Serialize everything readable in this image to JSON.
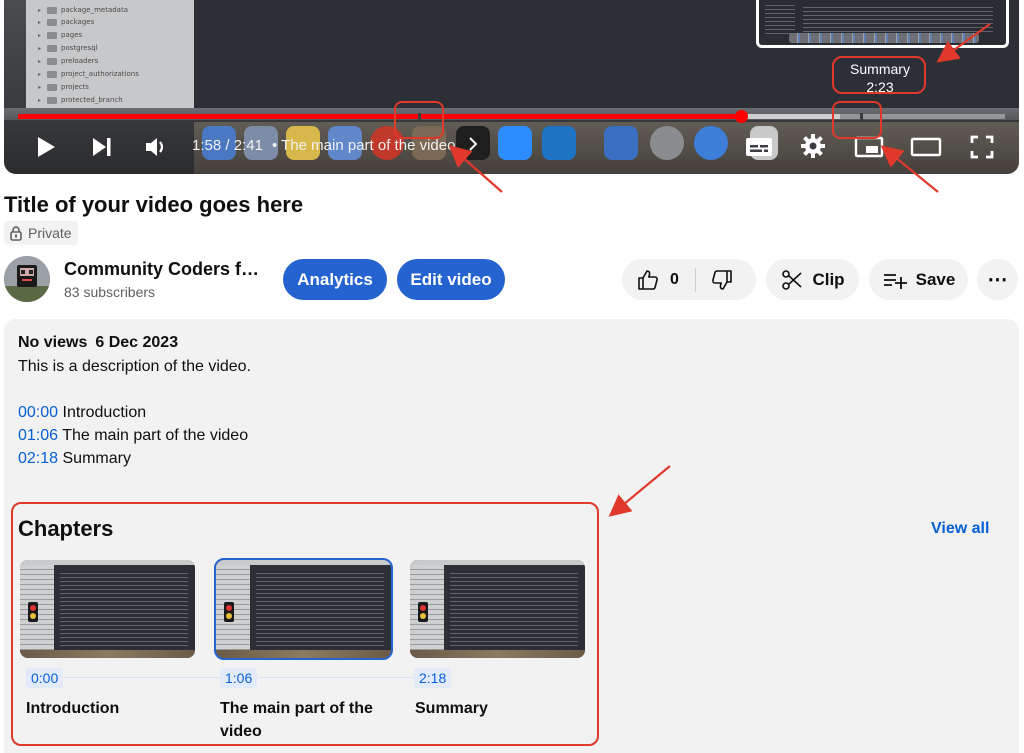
{
  "player": {
    "file_tree": [
      "package_metadata",
      "packages",
      "pages",
      "postgresql",
      "preloaders",
      "project_authorizations",
      "projects",
      "protected_branch"
    ],
    "time_current": "1:58",
    "time_separator": "/",
    "time_total": "2:41",
    "chapter_separator": "•",
    "current_chapter": "The main part of the video",
    "progress_fraction": 0.733,
    "tooltip": {
      "title": "Summary",
      "time": "2:23"
    },
    "colors": {
      "progress": "#ff0000",
      "annotation": "#e0392b"
    }
  },
  "video": {
    "title": "Title of your video goes here",
    "visibility": "Private"
  },
  "channel": {
    "name": "Community Coders f…",
    "subscribers": "83 subscribers"
  },
  "actions": {
    "analytics": "Analytics",
    "edit_video": "Edit video",
    "likes": "0",
    "clip": "Clip",
    "save": "Save",
    "more": "⋯"
  },
  "description": {
    "views": "No views",
    "date": "6 Dec 2023",
    "text": "This is a description of the video.",
    "timestamps": [
      {
        "time": "00:00",
        "label": "Introduction"
      },
      {
        "time": "01:06",
        "label": "The main part of the video"
      },
      {
        "time": "02:18",
        "label": "Summary"
      }
    ]
  },
  "chapters": {
    "heading": "Chapters",
    "view_all": "View all",
    "items": [
      {
        "time": "0:00",
        "title": "Introduction",
        "active": false
      },
      {
        "time": "1:06",
        "title": "The main part of the video",
        "active": true
      },
      {
        "time": "2:18",
        "title": "Summary",
        "active": false
      }
    ]
  }
}
